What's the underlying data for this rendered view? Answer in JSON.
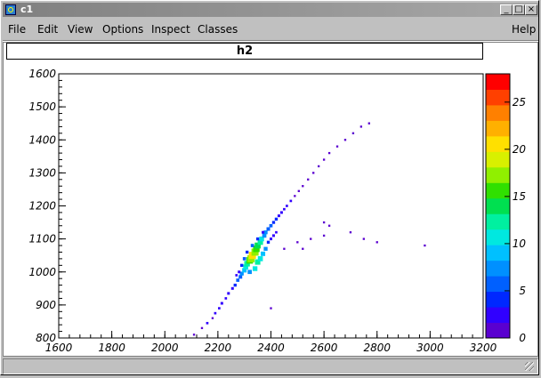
{
  "window": {
    "title": "c1",
    "min_glyph": "_",
    "max_glyph": "□",
    "close_glyph": "×"
  },
  "menu": {
    "file": "File",
    "edit": "Edit",
    "view": "View",
    "options": "Options",
    "inspect": "Inspect",
    "classes": "Classes",
    "help": "Help"
  },
  "plot": {
    "title": "h2"
  },
  "chart_data": {
    "type": "heatmap",
    "title": "h2",
    "xlabel": "",
    "ylabel": "",
    "xlim": [
      1600,
      3200
    ],
    "ylim": [
      800,
      1600
    ],
    "x_ticks": [
      1600,
      1800,
      2000,
      2200,
      2400,
      2600,
      2800,
      3000,
      3200
    ],
    "y_ticks": [
      800,
      900,
      1000,
      1100,
      1200,
      1300,
      1400,
      1500,
      1600
    ],
    "colorbar": {
      "range": [
        0,
        28
      ],
      "ticks": [
        0,
        5,
        10,
        15,
        20,
        25
      ]
    },
    "grid": false,
    "points": [
      [
        2110,
        810,
        1
      ],
      [
        2140,
        830,
        1
      ],
      [
        2160,
        845,
        2
      ],
      [
        2180,
        860,
        1
      ],
      [
        2190,
        875,
        2
      ],
      [
        2205,
        890,
        2
      ],
      [
        2215,
        905,
        3
      ],
      [
        2230,
        920,
        2
      ],
      [
        2240,
        935,
        3
      ],
      [
        2255,
        950,
        3
      ],
      [
        2265,
        960,
        4
      ],
      [
        2275,
        975,
        5
      ],
      [
        2285,
        985,
        6
      ],
      [
        2290,
        995,
        7
      ],
      [
        2300,
        1005,
        9
      ],
      [
        2305,
        1015,
        11
      ],
      [
        2310,
        1025,
        13
      ],
      [
        2320,
        1035,
        16
      ],
      [
        2325,
        1040,
        18
      ],
      [
        2330,
        1050,
        20
      ],
      [
        2340,
        1060,
        18
      ],
      [
        2345,
        1070,
        16
      ],
      [
        2350,
        1080,
        14
      ],
      [
        2360,
        1090,
        12
      ],
      [
        2365,
        1100,
        10
      ],
      [
        2375,
        1110,
        8
      ],
      [
        2380,
        1120,
        7
      ],
      [
        2390,
        1130,
        6
      ],
      [
        2400,
        1140,
        5
      ],
      [
        2410,
        1150,
        4
      ],
      [
        2420,
        1160,
        4
      ],
      [
        2430,
        1170,
        3
      ],
      [
        2440,
        1180,
        3
      ],
      [
        2450,
        1190,
        2
      ],
      [
        2460,
        1200,
        2
      ],
      [
        2475,
        1215,
        2
      ],
      [
        2490,
        1230,
        1
      ],
      [
        2505,
        1245,
        1
      ],
      [
        2520,
        1260,
        1
      ],
      [
        2540,
        1280,
        1
      ],
      [
        2560,
        1300,
        1
      ],
      [
        2580,
        1320,
        1
      ],
      [
        2600,
        1340,
        1
      ],
      [
        2620,
        1360,
        1
      ],
      [
        2650,
        1380,
        1
      ],
      [
        2680,
        1400,
        1
      ],
      [
        2710,
        1420,
        1
      ],
      [
        2740,
        1440,
        1
      ],
      [
        2770,
        1450,
        1
      ],
      [
        2320,
        1000,
        8
      ],
      [
        2340,
        1010,
        10
      ],
      [
        2350,
        1030,
        12
      ],
      [
        2360,
        1040,
        11
      ],
      [
        2370,
        1055,
        9
      ],
      [
        2380,
        1070,
        7
      ],
      [
        2300,
        1040,
        5
      ],
      [
        2310,
        1060,
        4
      ],
      [
        2330,
        1080,
        5
      ],
      [
        2350,
        1100,
        4
      ],
      [
        2370,
        1120,
        3
      ],
      [
        2290,
        1020,
        4
      ],
      [
        2280,
        1000,
        3
      ],
      [
        2270,
        990,
        2
      ],
      [
        2400,
        1100,
        3
      ],
      [
        2420,
        1120,
        2
      ],
      [
        2390,
        1090,
        4
      ],
      [
        2410,
        1110,
        3
      ],
      [
        2500,
        1090,
        1
      ],
      [
        2550,
        1100,
        1
      ],
      [
        2600,
        1110,
        1
      ],
      [
        2700,
        1120,
        1
      ],
      [
        2800,
        1090,
        1
      ],
      [
        2980,
        1080,
        1
      ],
      [
        2450,
        1070,
        1
      ],
      [
        2520,
        1070,
        1
      ],
      [
        2620,
        1140,
        1
      ],
      [
        2750,
        1100,
        1
      ],
      [
        2400,
        890,
        1
      ],
      [
        2600,
        1150,
        1
      ]
    ]
  }
}
